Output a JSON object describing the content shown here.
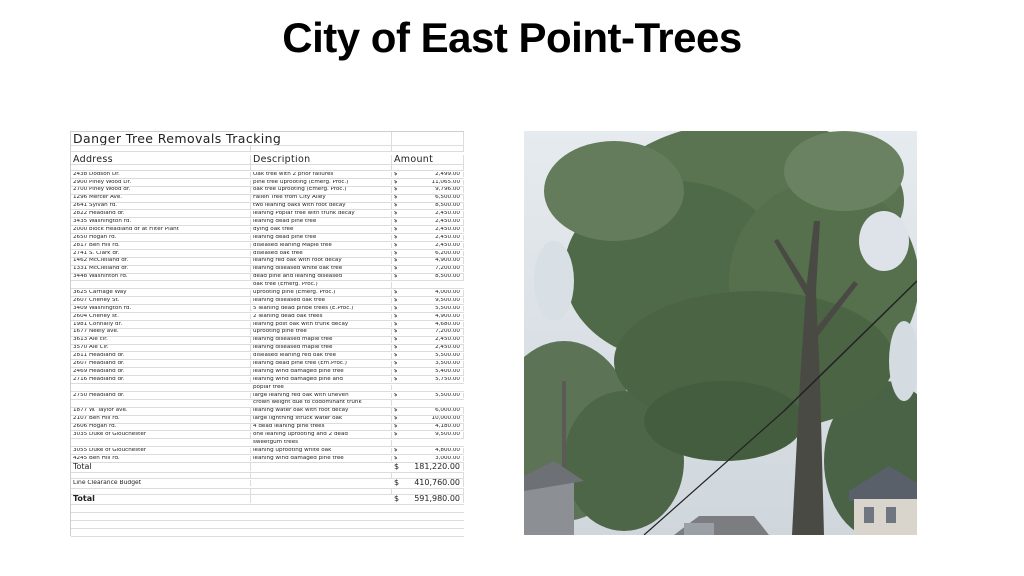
{
  "slide": {
    "title": "City of East Point-Trees"
  },
  "sheet": {
    "title": "Danger Tree Removals Tracking",
    "col_address": "Address",
    "col_description": "Description",
    "col_amount": "Amount",
    "currency": "$",
    "rows": [
      {
        "address": "2438 Dodson Dr.",
        "description": "Oak tree with 2 prior failures",
        "amount": "2,499.00"
      },
      {
        "address": "2900 Piney Wood Dr.",
        "description": "pine tree uprooting (Emerg. Proc.)",
        "amount": "11,065.00"
      },
      {
        "address": "2700 Piney Wood dr.",
        "description": "oak tree uprooting (Emerg. Proc.)",
        "amount": "9,796.00"
      },
      {
        "address": "1296 Mercer Ave.",
        "description": "Fallen Tree from City Alley",
        "amount": "6,500.00"
      },
      {
        "address": "2641 Sylvan rd.",
        "description": "two leaning oaks with root decay",
        "amount": "8,500.00"
      },
      {
        "address": "2822 Headland dr.",
        "description": "leaning Poplar tree with trunk decay",
        "amount": "2,450.00"
      },
      {
        "address": "3435 Washington rd.",
        "description": "leaning dead pine tree",
        "amount": "2,450.00"
      },
      {
        "address": "2000 block Headland dr at Filter Plant",
        "description": "dying oak tree",
        "amount": "2,450.00"
      },
      {
        "address": "2650 Hogan rd.",
        "description": "leaning dead pine tree",
        "amount": "2,450.00"
      },
      {
        "address": "2817 Ben Hill rd.",
        "description": "diseased leaning Maple tree",
        "amount": "2,450.00"
      },
      {
        "address": "2741 S. Clark dr.",
        "description": "diseased oak tree",
        "amount": "6,200.00"
      },
      {
        "address": "1462 McClelland dr.",
        "description": "leaning red oak with root decay",
        "amount": "4,900.00"
      },
      {
        "address": "1331 McClelland dr.",
        "description": "leaning diseased white oak tree",
        "amount": "7,200.00"
      },
      {
        "address": "3448 Washinton rd.",
        "description": "dead pine and leaning diseased",
        "amount": "8,500.00"
      },
      {
        "address": "",
        "description": "oak tree (Emerg. Proc.)",
        "amount": ""
      },
      {
        "address": "3625 Carriage Way",
        "description": "uprooting pine (Emerg. Proc.)",
        "amount": "4,000.00"
      },
      {
        "address": "2607 Cheney St.",
        "description": "leaning diseased oak tree",
        "amount": "9,500.00"
      },
      {
        "address": "3409 Washington rd.",
        "description": "5 leaning dead pinbe trees (E.Proc.)",
        "amount": "5,500.00"
      },
      {
        "address": "2604 Cheney st.",
        "description": "2 leaning dead oak trees",
        "amount": "4,900.00"
      },
      {
        "address": "1981 Connally dr.",
        "description": "leaning post oak with trunk decay",
        "amount": "4,680.00"
      },
      {
        "address": "1677 Neely ave.",
        "description": "uprooting pine tree",
        "amount": "7,200.00"
      },
      {
        "address": "3613 Ale cir.",
        "description": "leaning diseased maple tree",
        "amount": "2,450.00"
      },
      {
        "address": "3570 Ale Cir.",
        "description": "leaning diseased maple tree",
        "amount": "2,450.00"
      },
      {
        "address": "2811 Headland dr.",
        "description": "diseased leaning red oak tree",
        "amount": "5,500.00"
      },
      {
        "address": "2607 Headland dr.",
        "description": "leaning dead pine tree (Em.Proc.)",
        "amount": "3,500.00"
      },
      {
        "address": "2469 Headland dr.",
        "description": "leaning wind damaged pine tree",
        "amount": "5,400.00"
      },
      {
        "address": "2716 Headland dr.",
        "description": "leaning wind damaged pine and",
        "amount": "5,750.00"
      },
      {
        "address": "",
        "description": "poplar tree",
        "amount": ""
      },
      {
        "address": "2750 Headland dr.",
        "description": "large leaning red oak with uneven",
        "amount": "5,500.00"
      },
      {
        "address": "",
        "description": "crown weight due to codominant trunk",
        "amount": ""
      },
      {
        "address": "1877 W. Taylor ave.",
        "description": " leaning water oak with root decay",
        "amount": "6,000.00"
      },
      {
        "address": "2107 Ben Hill rd.",
        "description": "large lightning struck water oak",
        "amount": "10,000.00"
      },
      {
        "address": "2606 Hogan rd.",
        "description": "4 dead leaning pine trees",
        "amount": "4,180.00"
      },
      {
        "address": "3035 Duke of Glouchester",
        "description": "one leaning uprooting and 2 dead",
        "amount": "9,500.00"
      },
      {
        "address": "",
        "description": "sweetgum trees",
        "amount": ""
      },
      {
        "address": "3055 Duke of Glouchester",
        "description": "leaning uprooting white oak",
        "amount": "4,800.00"
      },
      {
        "address": "4245 Ben Hill rd.",
        "description": "leaning wind damaged pine tree",
        "amount": "3,000.00"
      }
    ],
    "total_label": "Total",
    "total_amount": "181,220.00",
    "budget_label": "Line Clearance Budget",
    "budget_amount": "410,760.00",
    "grand_total_label": "Total",
    "grand_total_amount": "591,980.00"
  },
  "photo": {
    "subject": "tall-oak-tree-street-photo"
  }
}
